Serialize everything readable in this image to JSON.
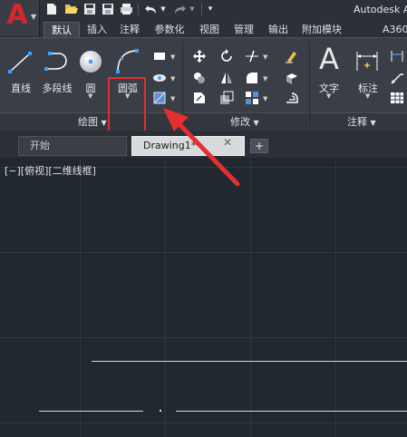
{
  "app": {
    "title": "Autodesk A",
    "logo_letter": "A"
  },
  "quick_access": {
    "icons": [
      "new-icon",
      "open-icon",
      "save-icon",
      "save-as-icon",
      "print-icon",
      "undo-icon",
      "redo-icon"
    ]
  },
  "ribbon_tabs": [
    "默认",
    "插入",
    "注释",
    "参数化",
    "视图",
    "管理",
    "输出",
    "附加模块",
    "A360"
  ],
  "active_tab": "默认",
  "draw_panel": {
    "title": "绘图",
    "tools": {
      "line": "直线",
      "polyline": "多段线",
      "circle": "圆",
      "arc": "圆弧"
    }
  },
  "modify_panel": {
    "title": "修改"
  },
  "annotation_panel": {
    "title": "注释",
    "tools": {
      "text": "文字",
      "dimension": "标注",
      "text_glyph": "A"
    }
  },
  "doc_tabs": {
    "start": "开始",
    "drawing": "Drawing1*",
    "close_glyph": "✕",
    "add_glyph": "+"
  },
  "canvas": {
    "viewport_label": "[−][俯视][二维线框]"
  },
  "colors": {
    "accent": "#d8262b",
    "highlight": "#e32f2f",
    "canvas_bg": "#212830"
  }
}
